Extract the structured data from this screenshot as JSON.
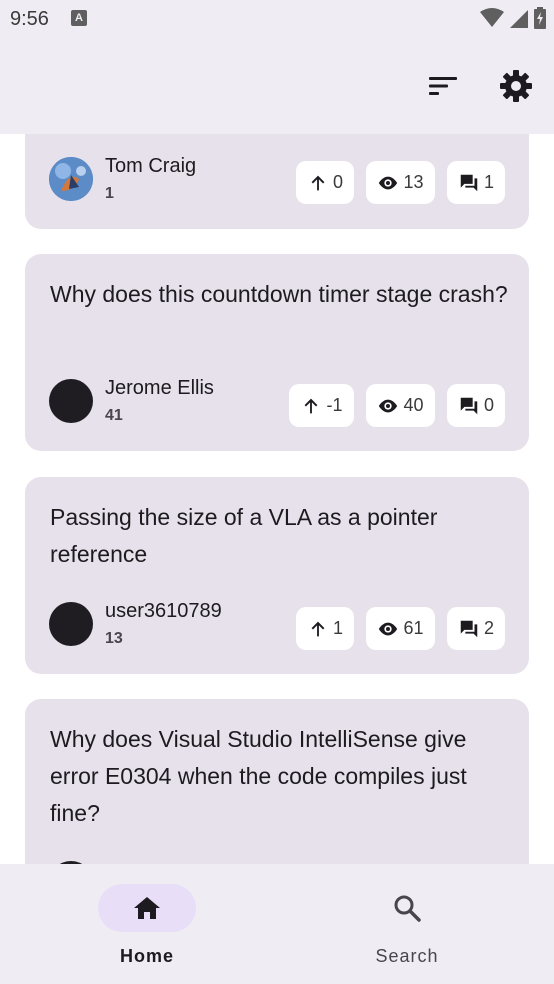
{
  "status": {
    "time": "9:56",
    "a_badge": "A"
  },
  "toolbar": {
    "sort_icon": "sort-icon",
    "settings_icon": "gear-icon"
  },
  "questions": [
    {
      "title": "",
      "user": "Tom Craig",
      "reputation": "1",
      "votes": "0",
      "views": "13",
      "answers": "1"
    },
    {
      "title": "Why does this countdown timer stage crash?",
      "user": "Jerome Ellis",
      "reputation": "41",
      "votes": "-1",
      "views": "40",
      "answers": "0"
    },
    {
      "title": "Passing the size of a VLA as a pointer reference",
      "user": "user3610789",
      "reputation": "13",
      "votes": "1",
      "views": "61",
      "answers": "2"
    },
    {
      "title": "Why does Visual Studio IntelliSense give error E0304 when the code compiles just fine?",
      "user": "",
      "reputation": "",
      "votes": "",
      "views": "",
      "answers": ""
    }
  ],
  "nav": {
    "home_label": "Home",
    "search_label": "Search"
  },
  "colors": {
    "accent_indicator": "#e8def8",
    "card_bg": "#e6e1ea",
    "surface": "#efedf3"
  }
}
